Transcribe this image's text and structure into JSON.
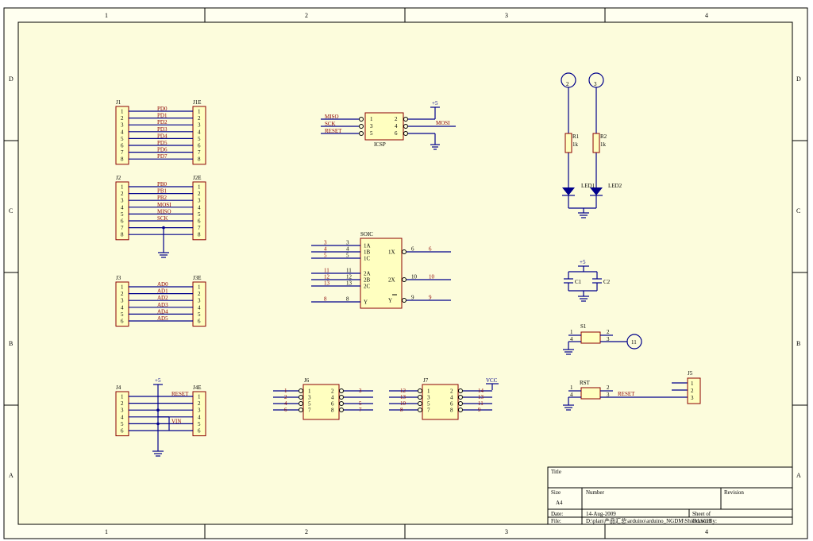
{
  "zones": {
    "columns": [
      "1",
      "2",
      "3",
      "4"
    ],
    "rows": [
      "D",
      "C",
      "B",
      "A"
    ]
  },
  "headers": [
    {
      "left": "J1",
      "right": "J1E",
      "pins": [
        "1",
        "2",
        "3",
        "4",
        "5",
        "6",
        "7",
        "8"
      ],
      "nets": [
        "PD0",
        "PD1",
        "PD2",
        "PD3",
        "PD4",
        "PD5",
        "PD6",
        "PD7"
      ]
    },
    {
      "left": "J2",
      "right": "J2E",
      "pins": [
        "1",
        "2",
        "3",
        "4",
        "5",
        "6",
        "7",
        "8"
      ],
      "nets": [
        "PB0",
        "PB1",
        "PB2",
        "MOSI",
        "MISO",
        "SCK",
        "",
        ""
      ]
    },
    {
      "left": "J3",
      "right": "J3E",
      "pins": [
        "1",
        "2",
        "3",
        "4",
        "5",
        "6"
      ],
      "nets": [
        "AD0",
        "AD1",
        "AD2",
        "AD3",
        "AD4",
        "AD5"
      ]
    },
    {
      "left": "J4",
      "right": "J4E",
      "pins": [
        "1",
        "2",
        "3",
        "4",
        "5",
        "6"
      ],
      "nets": [
        "RESET",
        "",
        "",
        "",
        "VIN",
        ""
      ],
      "power": "+5"
    }
  ],
  "icsp": {
    "designator": "ICSP",
    "left_nets": [
      "MISO",
      "SCK",
      "RESET"
    ],
    "left_pins": [
      "1",
      "3",
      "5"
    ],
    "right_pins": [
      "2",
      "4",
      "6"
    ],
    "right_net": "MOSI",
    "power": "+5"
  },
  "soic": {
    "designator": "SOIC",
    "inputs": [
      {
        "num": "3",
        "name": "1A"
      },
      {
        "num": "4",
        "name": "1B"
      },
      {
        "num": "5",
        "name": "1C"
      },
      {
        "num": "11",
        "name": "2A"
      },
      {
        "num": "12",
        "name": "2B"
      },
      {
        "num": "13",
        "name": "2C"
      },
      {
        "num": "8",
        "name": "Y"
      }
    ],
    "outputs": [
      {
        "num": "6",
        "name": "1X"
      },
      {
        "num": "10",
        "name": "2X"
      },
      {
        "num": "9",
        "name": "Y"
      }
    ]
  },
  "j6": {
    "designator": "J6",
    "left_pins": [
      "1",
      "3",
      "5",
      "7"
    ],
    "right_pins": [
      "2",
      "4",
      "6",
      "8"
    ],
    "left_nets": [
      "1",
      "2",
      "4",
      "6"
    ],
    "right_nets": [
      "3",
      "",
      "5",
      "7"
    ]
  },
  "j7": {
    "designator": "J7",
    "left_pins": [
      "1",
      "3",
      "5",
      "7"
    ],
    "right_pins": [
      "2",
      "4",
      "6",
      "8"
    ],
    "left_nets": [
      "12",
      "13",
      "10",
      "8"
    ],
    "right_nets": [
      "14",
      "13",
      "11",
      "9"
    ],
    "power": "VCC"
  },
  "leds": [
    {
      "port": "2",
      "resistor": "R1",
      "value": "1k",
      "led": "LED1"
    },
    {
      "port": "3",
      "resistor": "R2",
      "value": "1k",
      "led": "LED2"
    }
  ],
  "caps": {
    "power": "+5",
    "c1": "C1",
    "c2": "C2"
  },
  "s1": {
    "designator": "S1",
    "pins": [
      "1",
      "2",
      "4",
      "3"
    ],
    "port": "11"
  },
  "rst": {
    "designator": "RST",
    "pins": [
      "1",
      "2",
      "4",
      "3"
    ],
    "net": "RESET"
  },
  "j5": {
    "designator": "J5",
    "pins": [
      "1",
      "2",
      "3"
    ]
  },
  "title_block": {
    "title_label": "Title",
    "size_label": "Size",
    "size_value": "A4",
    "number_label": "Number",
    "revision_label": "Revision",
    "date_label": "Date:",
    "date_value": "14-Aug-2009",
    "file_label": "File:",
    "file_value": "D:\\plan\\产品汇总\\arduino\\arduino_NGDM\\Shield.SCH",
    "sheet_label": "Sheet    of",
    "drawn_label": "Drawn By:"
  },
  "colors": {
    "wire": "#00008b",
    "net_label": "#8b0000",
    "component_fill": "#ffffc0",
    "sheet_fill": "#fcfcdc"
  }
}
